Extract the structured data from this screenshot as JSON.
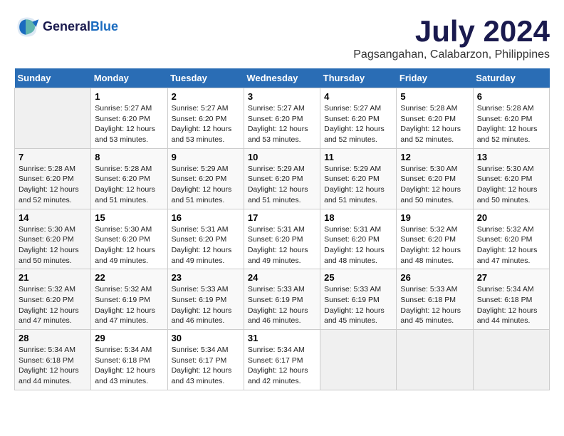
{
  "header": {
    "logo_line1": "General",
    "logo_line2": "Blue",
    "title": "July 2024",
    "subtitle": "Pagsangahan, Calabarzon, Philippines"
  },
  "calendar": {
    "days_of_week": [
      "Sunday",
      "Monday",
      "Tuesday",
      "Wednesday",
      "Thursday",
      "Friday",
      "Saturday"
    ],
    "weeks": [
      [
        {
          "day": "",
          "info": ""
        },
        {
          "day": "1",
          "info": "Sunrise: 5:27 AM\nSunset: 6:20 PM\nDaylight: 12 hours\nand 53 minutes."
        },
        {
          "day": "2",
          "info": "Sunrise: 5:27 AM\nSunset: 6:20 PM\nDaylight: 12 hours\nand 53 minutes."
        },
        {
          "day": "3",
          "info": "Sunrise: 5:27 AM\nSunset: 6:20 PM\nDaylight: 12 hours\nand 53 minutes."
        },
        {
          "day": "4",
          "info": "Sunrise: 5:27 AM\nSunset: 6:20 PM\nDaylight: 12 hours\nand 52 minutes."
        },
        {
          "day": "5",
          "info": "Sunrise: 5:28 AM\nSunset: 6:20 PM\nDaylight: 12 hours\nand 52 minutes."
        },
        {
          "day": "6",
          "info": "Sunrise: 5:28 AM\nSunset: 6:20 PM\nDaylight: 12 hours\nand 52 minutes."
        }
      ],
      [
        {
          "day": "7",
          "info": "Sunrise: 5:28 AM\nSunset: 6:20 PM\nDaylight: 12 hours\nand 52 minutes."
        },
        {
          "day": "8",
          "info": "Sunrise: 5:28 AM\nSunset: 6:20 PM\nDaylight: 12 hours\nand 51 minutes."
        },
        {
          "day": "9",
          "info": "Sunrise: 5:29 AM\nSunset: 6:20 PM\nDaylight: 12 hours\nand 51 minutes."
        },
        {
          "day": "10",
          "info": "Sunrise: 5:29 AM\nSunset: 6:20 PM\nDaylight: 12 hours\nand 51 minutes."
        },
        {
          "day": "11",
          "info": "Sunrise: 5:29 AM\nSunset: 6:20 PM\nDaylight: 12 hours\nand 51 minutes."
        },
        {
          "day": "12",
          "info": "Sunrise: 5:30 AM\nSunset: 6:20 PM\nDaylight: 12 hours\nand 50 minutes."
        },
        {
          "day": "13",
          "info": "Sunrise: 5:30 AM\nSunset: 6:20 PM\nDaylight: 12 hours\nand 50 minutes."
        }
      ],
      [
        {
          "day": "14",
          "info": "Sunrise: 5:30 AM\nSunset: 6:20 PM\nDaylight: 12 hours\nand 50 minutes."
        },
        {
          "day": "15",
          "info": "Sunrise: 5:30 AM\nSunset: 6:20 PM\nDaylight: 12 hours\nand 49 minutes."
        },
        {
          "day": "16",
          "info": "Sunrise: 5:31 AM\nSunset: 6:20 PM\nDaylight: 12 hours\nand 49 minutes."
        },
        {
          "day": "17",
          "info": "Sunrise: 5:31 AM\nSunset: 6:20 PM\nDaylight: 12 hours\nand 49 minutes."
        },
        {
          "day": "18",
          "info": "Sunrise: 5:31 AM\nSunset: 6:20 PM\nDaylight: 12 hours\nand 48 minutes."
        },
        {
          "day": "19",
          "info": "Sunrise: 5:32 AM\nSunset: 6:20 PM\nDaylight: 12 hours\nand 48 minutes."
        },
        {
          "day": "20",
          "info": "Sunrise: 5:32 AM\nSunset: 6:20 PM\nDaylight: 12 hours\nand 47 minutes."
        }
      ],
      [
        {
          "day": "21",
          "info": "Sunrise: 5:32 AM\nSunset: 6:20 PM\nDaylight: 12 hours\nand 47 minutes."
        },
        {
          "day": "22",
          "info": "Sunrise: 5:32 AM\nSunset: 6:19 PM\nDaylight: 12 hours\nand 47 minutes."
        },
        {
          "day": "23",
          "info": "Sunrise: 5:33 AM\nSunset: 6:19 PM\nDaylight: 12 hours\nand 46 minutes."
        },
        {
          "day": "24",
          "info": "Sunrise: 5:33 AM\nSunset: 6:19 PM\nDaylight: 12 hours\nand 46 minutes."
        },
        {
          "day": "25",
          "info": "Sunrise: 5:33 AM\nSunset: 6:19 PM\nDaylight: 12 hours\nand 45 minutes."
        },
        {
          "day": "26",
          "info": "Sunrise: 5:33 AM\nSunset: 6:18 PM\nDaylight: 12 hours\nand 45 minutes."
        },
        {
          "day": "27",
          "info": "Sunrise: 5:34 AM\nSunset: 6:18 PM\nDaylight: 12 hours\nand 44 minutes."
        }
      ],
      [
        {
          "day": "28",
          "info": "Sunrise: 5:34 AM\nSunset: 6:18 PM\nDaylight: 12 hours\nand 44 minutes."
        },
        {
          "day": "29",
          "info": "Sunrise: 5:34 AM\nSunset: 6:18 PM\nDaylight: 12 hours\nand 43 minutes."
        },
        {
          "day": "30",
          "info": "Sunrise: 5:34 AM\nSunset: 6:17 PM\nDaylight: 12 hours\nand 43 minutes."
        },
        {
          "day": "31",
          "info": "Sunrise: 5:34 AM\nSunset: 6:17 PM\nDaylight: 12 hours\nand 42 minutes."
        },
        {
          "day": "",
          "info": ""
        },
        {
          "day": "",
          "info": ""
        },
        {
          "day": "",
          "info": ""
        }
      ]
    ]
  }
}
